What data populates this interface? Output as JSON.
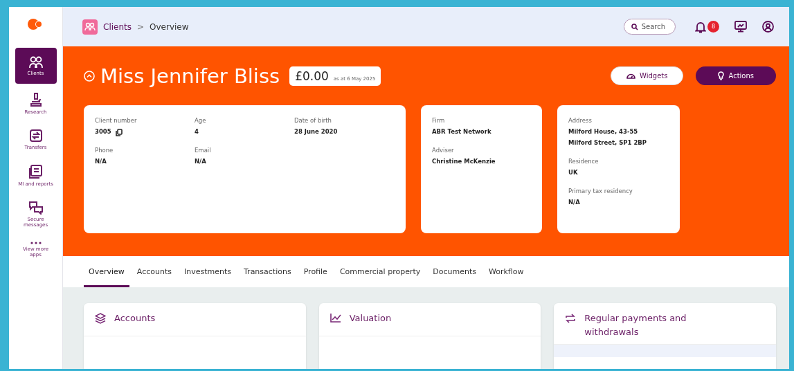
{
  "sidebar": {
    "items": [
      {
        "label": "Clients",
        "selected": true
      },
      {
        "label": "Research",
        "selected": false
      },
      {
        "label": "Transfers",
        "selected": false
      },
      {
        "label": "MI and reports",
        "selected": false
      },
      {
        "label": "Secure messages",
        "selected": false
      },
      {
        "label": "View more apps",
        "selected": false
      }
    ]
  },
  "breadcrumb": [
    "Clients",
    ">",
    "Overview"
  ],
  "header": {
    "search_label": "Search",
    "notifications": "8"
  },
  "client": {
    "name": "Miss Jennifer Bliss",
    "balance": "£0.00",
    "balance_date": "as at 6 May 2025",
    "buttons": [
      "Widgets",
      "Actions"
    ]
  },
  "cards": [
    {
      "fields": [
        {
          "label": "Client number",
          "value": "3005"
        },
        {
          "label": "Age",
          "value": "4"
        },
        {
          "label": "Date of birth",
          "value": "28 June 2020"
        },
        {
          "label": "Phone",
          "value": "N/A"
        },
        {
          "label": "Email",
          "value": "N/A"
        }
      ]
    },
    {
      "fields": [
        {
          "label": "Firm",
          "value": "ABR Test Network"
        },
        {
          "label": "Adviser",
          "value": "Christine McKenzie"
        }
      ]
    },
    {
      "fields": [
        {
          "label": "Address",
          "value": "Milford House, 43-55\nMilford Street, SP1 2BP"
        },
        {
          "label": "Residence",
          "value": "UK"
        },
        {
          "label": "Primary tax residency",
          "value": "N/A"
        }
      ]
    }
  ],
  "tabs": [
    {
      "label": "Overview",
      "selected": true
    },
    {
      "label": "Accounts",
      "selected": false
    },
    {
      "label": "Investments",
      "selected": false
    },
    {
      "label": "Transactions",
      "selected": false
    },
    {
      "label": "Profile",
      "selected": false
    },
    {
      "label": "Commercial property",
      "selected": false
    },
    {
      "label": "Documents",
      "selected": false
    },
    {
      "label": "Workflow",
      "selected": false
    }
  ],
  "panels": [
    {
      "title": "Accounts"
    },
    {
      "title": "Valuation"
    },
    {
      "title": "Regular payments and withdrawals"
    }
  ]
}
